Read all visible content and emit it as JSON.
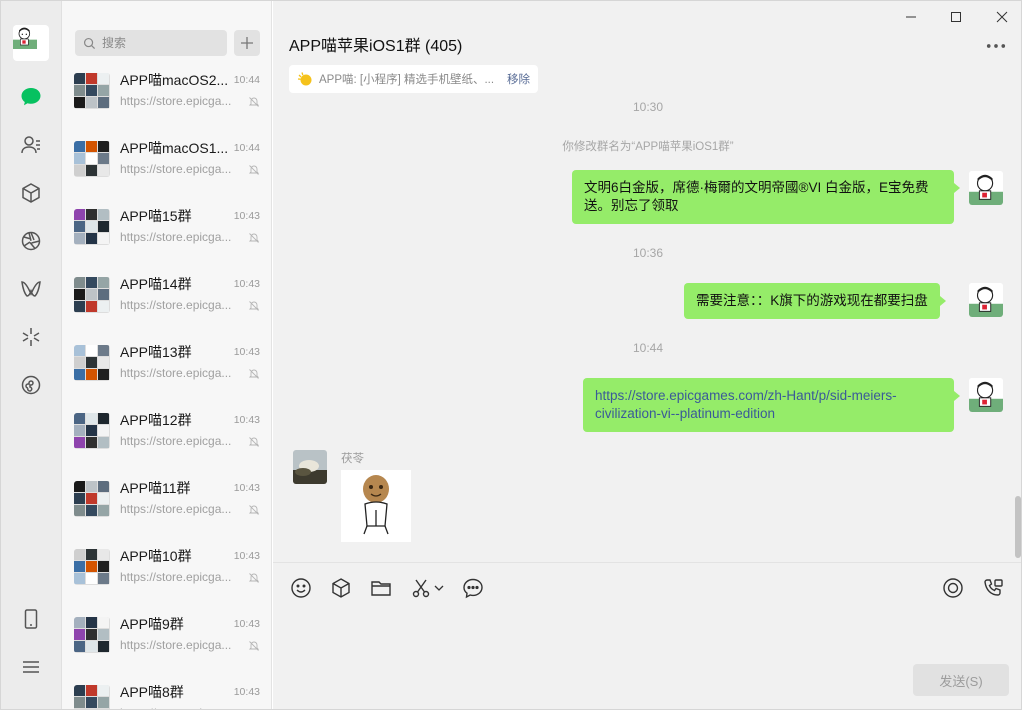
{
  "rail": {
    "icons": [
      "avatar",
      "chat-icon",
      "contacts-icon",
      "favorites-icon",
      "moments-icon",
      "channels-icon",
      "discover-icon",
      "mini-programs-icon",
      "phone-icon",
      "menu-icon"
    ],
    "accent": "#07c160"
  },
  "list": {
    "search_placeholder": "搜索",
    "chats": [
      {
        "name": "APP喵macOS2...",
        "time": "10:44",
        "preview": "https://store.epicga..."
      },
      {
        "name": "APP喵macOS1...",
        "time": "10:44",
        "preview": "https://store.epicga..."
      },
      {
        "name": "APP喵15群",
        "time": "10:43",
        "preview": "https://store.epicga..."
      },
      {
        "name": "APP喵14群",
        "time": "10:43",
        "preview": "https://store.epicga..."
      },
      {
        "name": "APP喵13群",
        "time": "10:43",
        "preview": "https://store.epicga..."
      },
      {
        "name": "APP喵12群",
        "time": "10:43",
        "preview": "https://store.epicga..."
      },
      {
        "name": "APP喵11群",
        "time": "10:43",
        "preview": "https://store.epicga..."
      },
      {
        "name": "APP喵10群",
        "time": "10:43",
        "preview": "https://store.epicga..."
      },
      {
        "name": "APP喵9群",
        "time": "10:43",
        "preview": "https://store.epicga..."
      },
      {
        "name": "APP喵8群",
        "time": "10:43",
        "preview": "https://store.epicga..."
      }
    ]
  },
  "chat": {
    "title": "APP喵苹果iOS1群 (405)",
    "pinned_text": "APP喵: [小程序] 精选手机壁纸、...",
    "pinned_remove": "移除",
    "timestamps": [
      "10:30",
      "10:36",
      "10:44"
    ],
    "system_message": "你修改群名为“APP喵苹果iOS1群”",
    "messages": [
      {
        "line1": "文明6白金版，席德·梅爾的文明帝國®VI 白金版，E宝免费",
        "line2": "送。别忘了领取"
      },
      {
        "line1": "需要注意：：K旗下的游戏现在都要扫盘"
      },
      {
        "line1": "https://store.epicgames.com/zh-Hant/p/sid-meiers-",
        "line2": "civilization-vi--platinum-edition"
      }
    ],
    "other_sender": "茯苓",
    "bubble_color": "#95ec69",
    "link_color": "#3a5a98"
  },
  "input": {
    "send_label": "发送(S)"
  }
}
